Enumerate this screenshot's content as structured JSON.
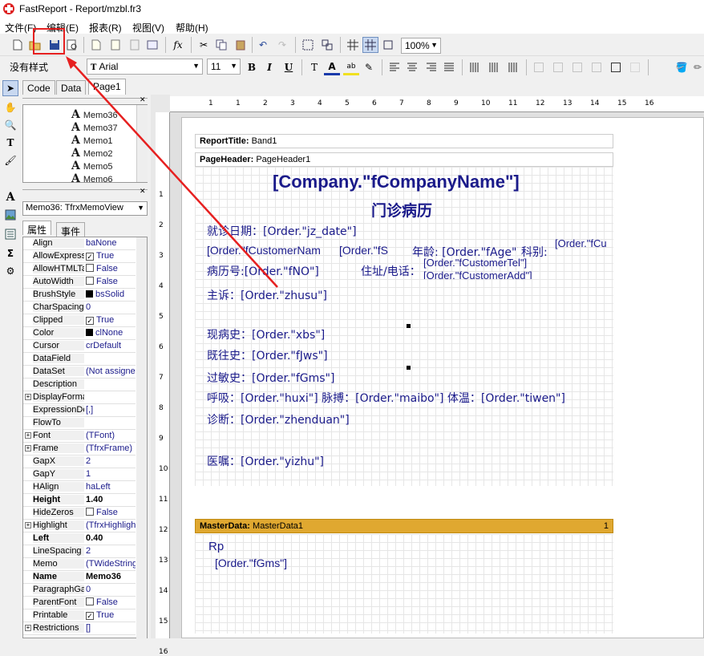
{
  "window": {
    "title": "FastReport - Report/mzbl.fr3"
  },
  "menu": {
    "file": "文件(F)",
    "edit": "编辑(E)",
    "report": "报表(R)",
    "view": "视图(V)",
    "help": "帮助(H)"
  },
  "toolbar": {
    "zoom": "100%",
    "style": "没有样式",
    "font": "Arial",
    "size": "11"
  },
  "panel": {
    "tabs": {
      "code": "Code",
      "data": "Data",
      "page": "Page1"
    },
    "tree": [
      "Memo36",
      "Memo37",
      "Memo1",
      "Memo2",
      "Memo5",
      "Memo6"
    ],
    "object": "Memo36: TfrxMemoView",
    "proptabs": {
      "props": "属性",
      "events": "事件"
    },
    "properties": [
      {
        "name": "Align",
        "value": "baNone"
      },
      {
        "name": "AllowExpress",
        "value": "True"
      },
      {
        "name": "AllowHTMLTa",
        "value": "False"
      },
      {
        "name": "AutoWidth",
        "value": "False"
      },
      {
        "name": "BrushStyle",
        "value": "bsSolid"
      },
      {
        "name": "CharSpacing",
        "value": "0"
      },
      {
        "name": "Clipped",
        "value": "True"
      },
      {
        "name": "Color",
        "value": "clNone"
      },
      {
        "name": "Cursor",
        "value": "crDefault"
      },
      {
        "name": "DataField",
        "value": ""
      },
      {
        "name": "DataSet",
        "value": "(Not assigned)"
      },
      {
        "name": "Description",
        "value": ""
      },
      {
        "name": "DisplayForma",
        "value": ""
      },
      {
        "name": "ExpressionDe",
        "value": "[,]"
      },
      {
        "name": "FlowTo",
        "value": ""
      },
      {
        "name": "Font",
        "value": "(TFont)"
      },
      {
        "name": "Frame",
        "value": "(TfrxFrame)"
      },
      {
        "name": "GapX",
        "value": "2"
      },
      {
        "name": "GapY",
        "value": "1"
      },
      {
        "name": "HAlign",
        "value": "haLeft"
      },
      {
        "name": "Height",
        "value": "1.40"
      },
      {
        "name": "HideZeros",
        "value": "False"
      },
      {
        "name": "Highlight",
        "value": "(TfrxHighlight)"
      },
      {
        "name": "Left",
        "value": "0.40"
      },
      {
        "name": "LineSpacing",
        "value": "2"
      },
      {
        "name": "Memo",
        "value": "(TWideStrings)"
      },
      {
        "name": "Name",
        "value": "Memo36"
      },
      {
        "name": "ParagraphGa",
        "value": "0"
      },
      {
        "name": "ParentFont",
        "value": "False"
      },
      {
        "name": "Printable",
        "value": "True"
      },
      {
        "name": "Restrictions",
        "value": "[]"
      }
    ]
  },
  "ruler": {
    "h": [
      "1",
      "1",
      "2",
      "3",
      "4",
      "5",
      "6",
      "7",
      "8",
      "9",
      "10",
      "11",
      "12",
      "13",
      "14",
      "15",
      "16"
    ],
    "v": [
      "1",
      "2",
      "3",
      "4",
      "5",
      "6",
      "7",
      "8",
      "9",
      "10",
      "11",
      "12",
      "13",
      "14",
      "15",
      "16"
    ]
  },
  "report": {
    "bands": {
      "title": {
        "kind": "ReportTitle:",
        "name": "Band1"
      },
      "header": {
        "kind": "PageHeader:",
        "name": "PageHeader1"
      },
      "master": {
        "kind": "MasterData:",
        "name": "MasterData1",
        "count": "1"
      }
    },
    "company": "[Company.\"fCompanyName\"]",
    "subtitle": "门诊病历",
    "m_date": "就诊日期：[Order.\"jz_date\"]",
    "m_name": "[Order.\"fCustomerNam",
    "m_sex": "[Order.\"fS",
    "m_age": "年龄: [Order.\"fAge\"]",
    "m_dept": "科别:",
    "m_deptv": "[Order.\"fCu",
    "m_no": "病历号:[Order.\"fNO\"]",
    "m_addr": "住址/电话：",
    "m_tel": "[Order.\"fCustomerTel\"]",
    "m_add2": "[Order.\"fCustomerAdd\"]",
    "m_zhusu": "主诉：[Order.\"zhusu\"]",
    "m_xbs": "现病史：[Order.\"xbs\"]",
    "m_jws": "既往史：[Order.\"fJws\"]",
    "m_gms": "过敏史：[Order.\"fGms\"]",
    "m_vital": "呼吸：[Order.\"huxi\"] 脉搏：[Order.\"maibo\"] 体温：[Order.\"tiwen\"]",
    "m_zd": "诊断：[Order.\"zhenduan\"]",
    "m_yz": "医嘱：[Order.\"yizhu\"]",
    "m_rp": "Rp",
    "m_fgms2": "[Order.\"fGms\"]"
  }
}
